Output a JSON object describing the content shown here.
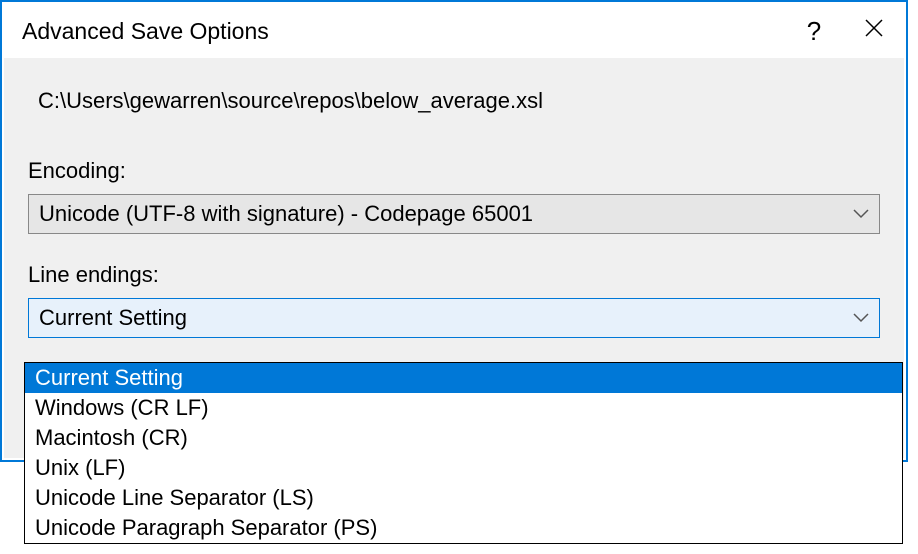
{
  "dialog": {
    "title": "Advanced Save Options",
    "file_path": "C:\\Users\\gewarren\\source\\repos\\below_average.xsl",
    "encoding_label": "Encoding:",
    "encoding_value": "Unicode (UTF-8 with signature) - Codepage 65001",
    "line_endings_label": "Line endings:",
    "line_endings_value": "Current Setting",
    "line_endings_options": [
      "Current Setting",
      "Windows (CR LF)",
      "Macintosh (CR)",
      "Unix (LF)",
      "Unicode Line Separator (LS)",
      "Unicode Paragraph Separator (PS)"
    ]
  }
}
